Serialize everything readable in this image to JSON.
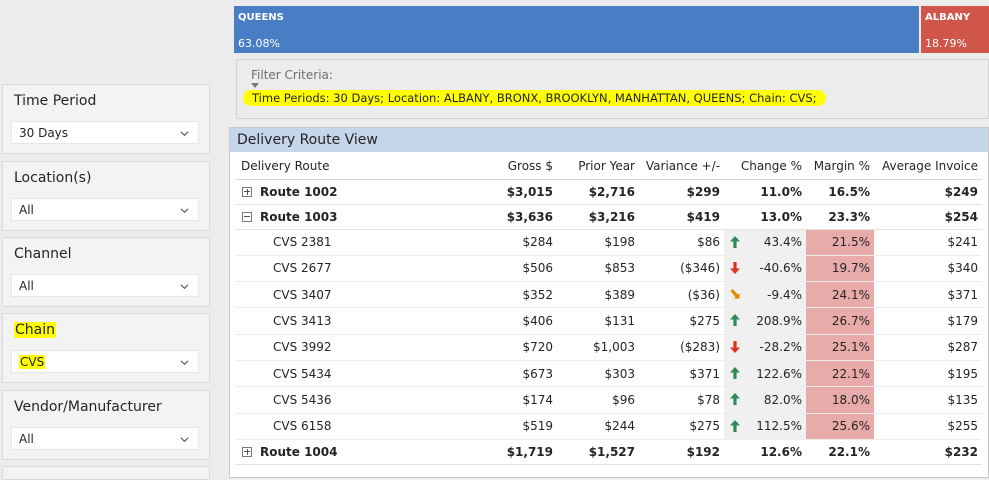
{
  "treemap": [
    {
      "name": "QUEENS",
      "value": "63.08%",
      "color": "#4a7ec4"
    },
    {
      "name": "ALBANY",
      "value": "18.79%",
      "color": "#d0564a"
    }
  ],
  "slicers": [
    {
      "title": "Time Period",
      "value": "30 Days"
    },
    {
      "title": "Location(s)",
      "value": "All"
    },
    {
      "title": "Channel",
      "value": "All"
    },
    {
      "title": "Chain",
      "value": "CVS"
    },
    {
      "title": "Vendor/Manufacturer",
      "value": "All"
    }
  ],
  "filter": {
    "label": "Filter Criteria:",
    "text": "Time Periods: 30 Days; Location: ALBANY, BRONX, BROOKLYN, MANHATTAN, QUEENS; Chain: CVS;"
  },
  "matrix": {
    "title": "Delivery Route View",
    "columns": [
      "Delivery Route",
      "Gross $",
      "Prior Year",
      "Variance +/-",
      "Change %",
      "Margin %",
      "Average Invoice"
    ],
    "rows": [
      {
        "type": "route",
        "expanded": false,
        "name": "Route 1002",
        "gross": "$3,015",
        "prior": "$2,716",
        "variance": "$299",
        "change": "11.0%",
        "margin": "16.5%",
        "avg": "$249"
      },
      {
        "type": "route",
        "expanded": true,
        "name": "Route 1003",
        "gross": "$3,636",
        "prior": "$3,216",
        "variance": "$419",
        "change": "13.0%",
        "margin": "23.3%",
        "avg": "$254"
      },
      {
        "type": "child",
        "name": "CVS 2381",
        "gross": "$284",
        "prior": "$198",
        "variance": "$86",
        "trend": "up",
        "change": "43.4%",
        "margin": "21.5%",
        "avg": "$241"
      },
      {
        "type": "child",
        "name": "CVS 2677",
        "gross": "$506",
        "prior": "$853",
        "variance": "($346)",
        "trend": "down",
        "change": "-40.6%",
        "margin": "19.7%",
        "avg": "$340"
      },
      {
        "type": "child",
        "name": "CVS 3407",
        "gross": "$352",
        "prior": "$389",
        "variance": "($36)",
        "trend": "down-slight",
        "change": "-9.4%",
        "margin": "24.1%",
        "avg": "$371"
      },
      {
        "type": "child",
        "name": "CVS 3413",
        "gross": "$406",
        "prior": "$131",
        "variance": "$275",
        "trend": "up",
        "change": "208.9%",
        "margin": "26.7%",
        "avg": "$179"
      },
      {
        "type": "child",
        "name": "CVS 3992",
        "gross": "$720",
        "prior": "$1,003",
        "variance": "($283)",
        "trend": "down",
        "change": "-28.2%",
        "margin": "25.1%",
        "avg": "$287"
      },
      {
        "type": "child",
        "name": "CVS 5434",
        "gross": "$673",
        "prior": "$303",
        "variance": "$371",
        "trend": "up",
        "change": "122.6%",
        "margin": "22.1%",
        "avg": "$195"
      },
      {
        "type": "child",
        "name": "CVS 5436",
        "gross": "$174",
        "prior": "$96",
        "variance": "$78",
        "trend": "up",
        "change": "82.0%",
        "margin": "18.0%",
        "avg": "$135"
      },
      {
        "type": "child",
        "name": "CVS 6158",
        "gross": "$519",
        "prior": "$244",
        "variance": "$275",
        "trend": "up",
        "change": "112.5%",
        "margin": "25.6%",
        "avg": "$255"
      },
      {
        "type": "route",
        "expanded": false,
        "name": "Route 1004",
        "gross": "$1,719",
        "prior": "$1,527",
        "variance": "$192",
        "change": "12.6%",
        "margin": "22.1%",
        "avg": "$232"
      }
    ]
  },
  "colors": {
    "trend_up": "#2e8b57",
    "trend_down": "#e0301e",
    "trend_down_slight": "#e08a00",
    "highlight": "#ffff00"
  }
}
